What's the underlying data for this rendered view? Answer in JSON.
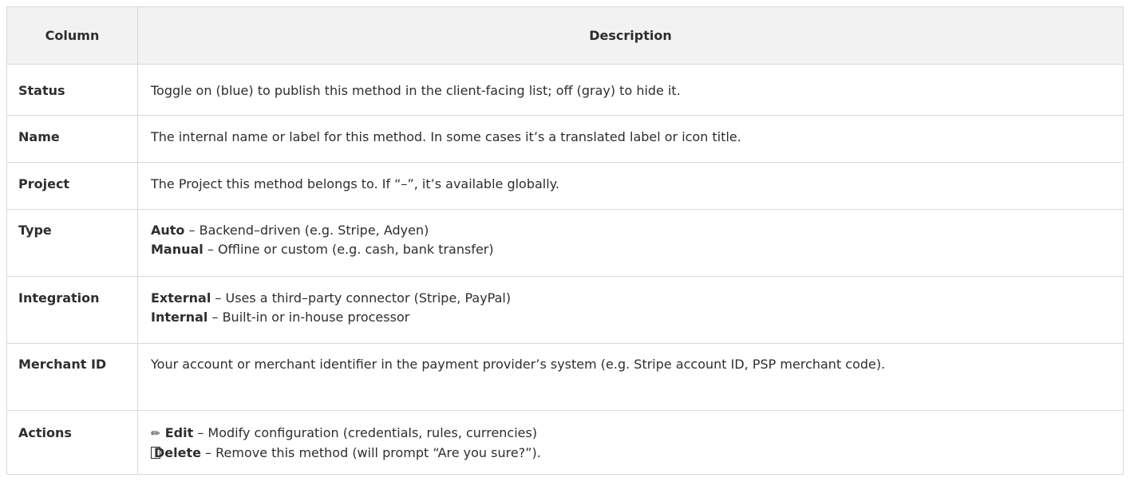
{
  "table": {
    "headers": [
      "Column",
      "Description"
    ],
    "rows": [
      {
        "name": "Status",
        "description": "Toggle on (blue) to publish this method in the client-facing list; off (gray) to hide it."
      },
      {
        "name": "Name",
        "description": "The internal name or label for this method. In some cases it’s a translated label or icon title."
      },
      {
        "name": "Project",
        "description": "The Project this method belongs to. If “–”, it’s available globally."
      },
      {
        "name": "Type",
        "lines": [
          {
            "term": "Auto",
            "rest": " – Backend–driven (e.g. Stripe, Adyen)"
          },
          {
            "term": "Manual",
            "rest": " – Offline or custom (e.g. cash, bank transfer)"
          }
        ]
      },
      {
        "name": "Integration",
        "lines": [
          {
            "term": "External",
            "rest": " – Uses a third–party connector (Stripe, PayPal)"
          },
          {
            "term": "Internal",
            "rest": " – Built-in or in-house processor"
          }
        ]
      },
      {
        "name": "Merchant ID",
        "description": "Your account or merchant identifier in the payment provider’s system (e.g. Stripe account ID, PSP merchant code)."
      },
      {
        "name": "Actions",
        "lines": [
          {
            "icon": "✏",
            "icon_name": "pencil-icon",
            "term": "Edit",
            "rest": " – Modify configuration (credentials, rules, currencies)"
          },
          {
            "icon": "",
            "icon_name": "trash-icon",
            "term": "Delete",
            "rest": " – Remove this method (will prompt “Are you sure?”)."
          }
        ]
      }
    ]
  }
}
